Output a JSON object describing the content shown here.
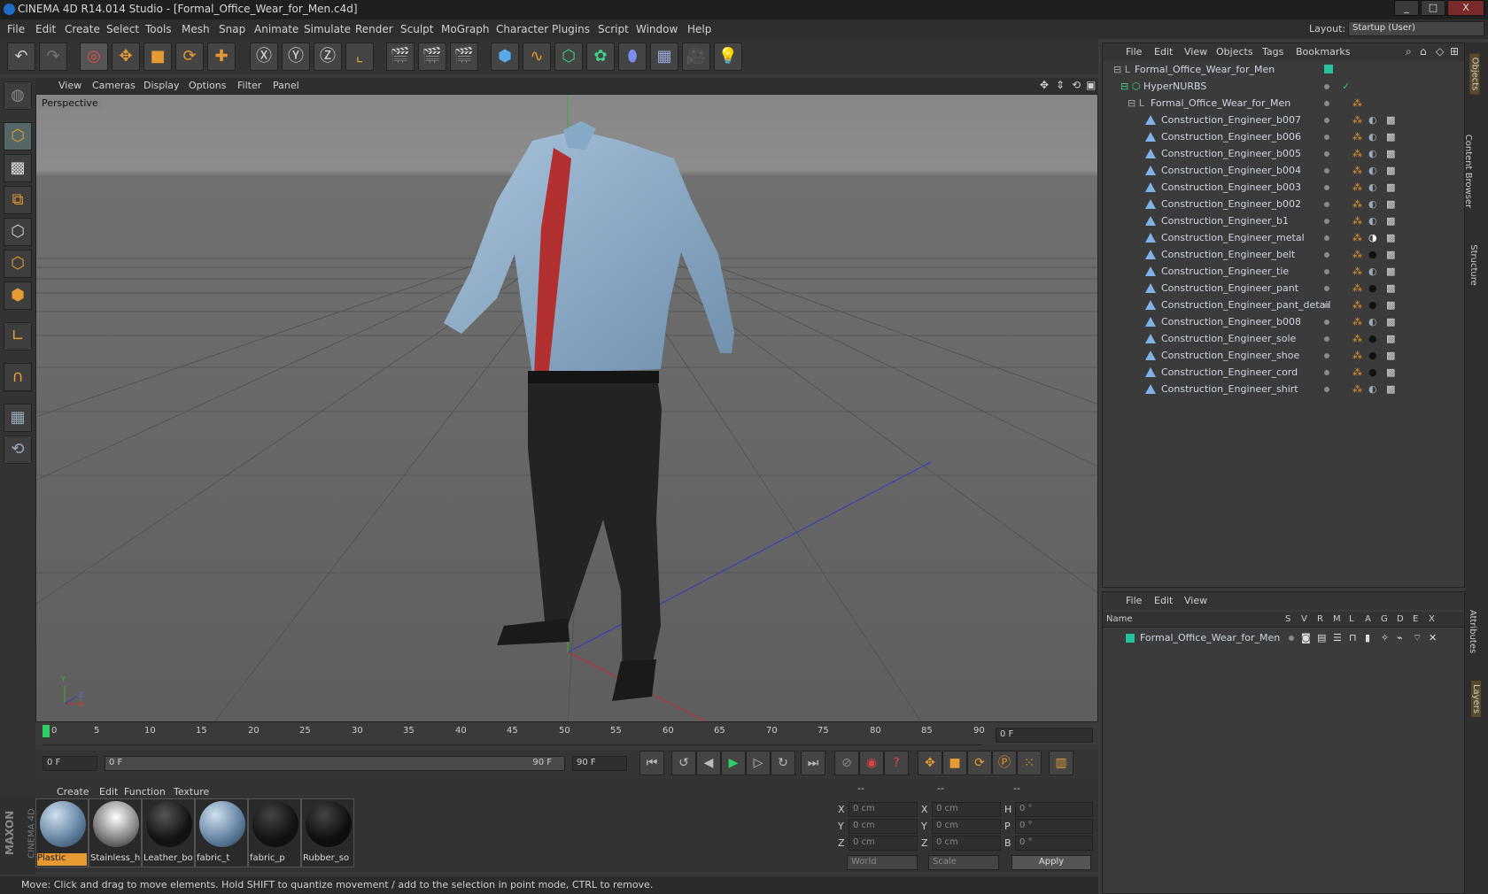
{
  "window": {
    "title": "CINEMA 4D R14.014 Studio - [Formal_Office_Wear_for_Men.c4d]",
    "minimize": "_",
    "maximize": "□",
    "close": "X"
  },
  "menu": [
    "File",
    "Edit",
    "Create",
    "Select",
    "Tools",
    "Mesh",
    "Snap",
    "Animate",
    "Simulate",
    "Render",
    "Sculpt",
    "MoGraph",
    "Character",
    "Plugins",
    "Script",
    "Window",
    "Help"
  ],
  "layout": {
    "label": "Layout:",
    "value": "Startup (User)"
  },
  "viewport": {
    "menu": [
      "View",
      "Cameras",
      "Display",
      "Options",
      "Filter",
      "Panel"
    ],
    "label": "Perspective",
    "axis_x": "X",
    "axis_y": "Y",
    "axis_z": "Z"
  },
  "timeline": {
    "ticks": [
      "0",
      "5",
      "10",
      "15",
      "20",
      "25",
      "30",
      "35",
      "40",
      "45",
      "50",
      "55",
      "60",
      "65",
      "70",
      "75",
      "80",
      "85",
      "90"
    ],
    "current_frame": "0 F",
    "start_field": "0 F",
    "range_start": "0 F",
    "range_end": "90 F",
    "end_field": "90 F"
  },
  "materials": {
    "menu": [
      "Create",
      "Edit",
      "Function",
      "Texture"
    ],
    "items": [
      {
        "label": "Plastic",
        "selected": true
      },
      {
        "label": "Stainless_h",
        "selected": false
      },
      {
        "label": "Leather_bo",
        "selected": false
      },
      {
        "label": "fabric_t",
        "selected": false
      },
      {
        "label": "fabric_p",
        "selected": false
      },
      {
        "label": "Rubber_so",
        "selected": false
      }
    ],
    "brand_line1": "MAXON",
    "brand_line2": "CINEMA 4D"
  },
  "coords": {
    "headers": [
      "--",
      "--",
      "--"
    ],
    "rows": [
      {
        "a_label": "X",
        "a_val": "0 cm",
        "b_label": "X",
        "b_val": "0 cm",
        "c_label": "H",
        "c_val": "0 °"
      },
      {
        "a_label": "Y",
        "a_val": "0 cm",
        "b_label": "Y",
        "b_val": "0 cm",
        "c_label": "P",
        "c_val": "0 °"
      },
      {
        "a_label": "Z",
        "a_val": "0 cm",
        "b_label": "Z",
        "b_val": "0 cm",
        "c_label": "B",
        "c_val": "0 °"
      }
    ],
    "world": "World",
    "scale": "Scale",
    "apply": "Apply"
  },
  "status": "Move: Click and drag to move elements. Hold SHIFT to quantize movement / add to the selection in point mode, CTRL to remove.",
  "objects_panel": {
    "menu": [
      "File",
      "Edit",
      "View",
      "Objects",
      "Tags",
      "Bookmarks"
    ],
    "root": "Formal_Office_Wear_for_Men",
    "hypernurbs": "HyperNURBS",
    "group": "Formal_Office_Wear_for_Men",
    "items": [
      "Construction_Engineer_b007",
      "Construction_Engineer_b006",
      "Construction_Engineer_b005",
      "Construction_Engineer_b004",
      "Construction_Engineer_b003",
      "Construction_Engineer_b002",
      "Construction_Engineer_b1",
      "Construction_Engineer_metal",
      "Construction_Engineer_belt",
      "Construction_Engineer_tie",
      "Construction_Engineer_pant",
      "Construction_Engineer_pant_detail",
      "Construction_Engineer_b008",
      "Construction_Engineer_sole",
      "Construction_Engineer_shoe",
      "Construction_Engineer_cord",
      "Construction_Engineer_shirt"
    ]
  },
  "layers_panel": {
    "menu": [
      "File",
      "Edit",
      "View"
    ],
    "col_name": "Name",
    "cols": [
      "S",
      "V",
      "R",
      "M",
      "L",
      "A",
      "G",
      "D",
      "E",
      "X"
    ],
    "layer": "Formal_Office_Wear_for_Men"
  },
  "side_tabs": [
    "Objects",
    "Content Browser",
    "Structure",
    "Attributes",
    "Layers"
  ],
  "colors": {
    "accent": "#e79a32",
    "layer": "#27c3a0",
    "tree_icon": "#7fb2e6"
  }
}
